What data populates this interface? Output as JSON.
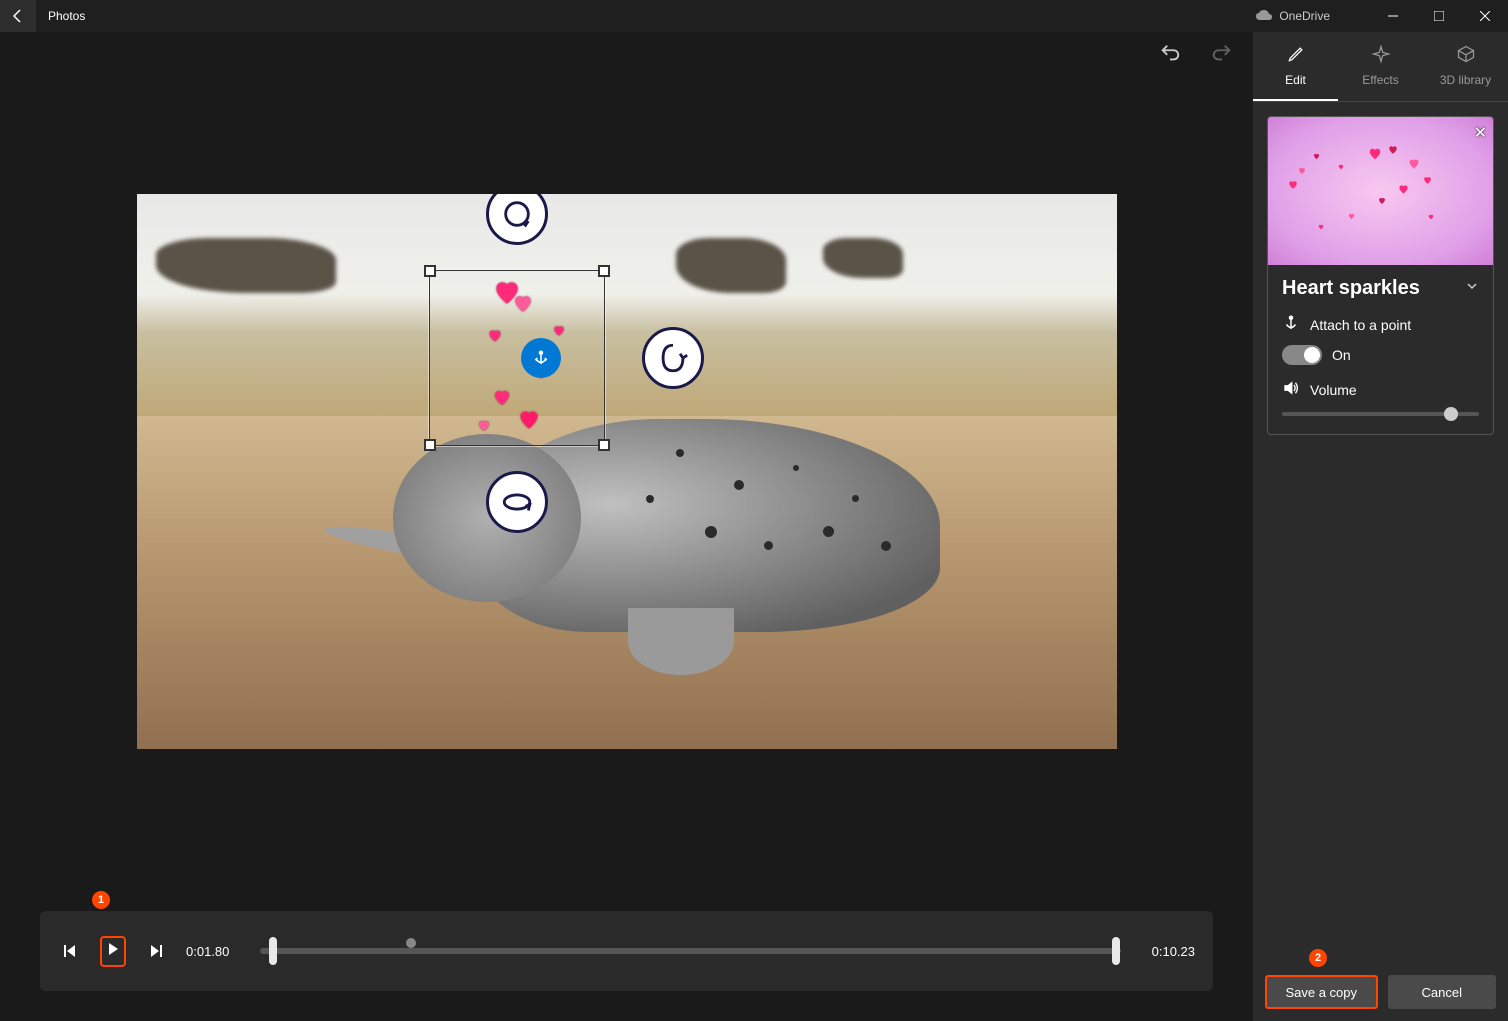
{
  "titlebar": {
    "app": "Photos",
    "onedrive": "OneDrive"
  },
  "undo": {
    "undo": "↶",
    "redo": "↷"
  },
  "playback": {
    "current_time": "0:01.80",
    "total_time": "0:10.23",
    "playhead_percent": 2,
    "right_trim_percent": 99,
    "marker_percent": 17
  },
  "callouts": {
    "play": "1",
    "save": "2"
  },
  "sidebar": {
    "tabs": {
      "edit": "Edit",
      "effects": "Effects",
      "library": "3D library"
    },
    "effect": {
      "name": "Heart sparkles",
      "attach_label": "Attach to a point",
      "toggle_state": "On",
      "volume_label": "Volume",
      "volume_percent": 82
    },
    "footer": {
      "save": "Save a copy",
      "cancel": "Cancel"
    }
  }
}
